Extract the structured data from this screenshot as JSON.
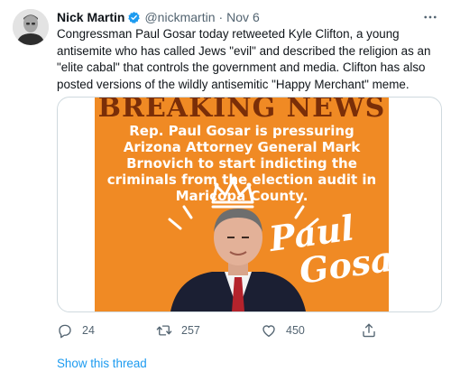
{
  "tweet": {
    "author_name": "Nick Martin",
    "handle": "@nickmartin",
    "separator": "·",
    "timestamp": "Nov 6",
    "body": "Congressman Paul Gosar today retweeted Kyle Clifton, a young antisemite who has called Jews \"evil\" and described the religion as an \"elite cabal\" that controls the government and media. Clifton has also posted versions of the wildly antisemitic \"Happy Merchant\" meme.",
    "media": {
      "headline": "BREAKING NEWS",
      "caption": "Rep. Paul Gosar is pressuring Arizona Attorney General Mark Brnovich to start indicting the criminals from the election audit in Maricopa County.",
      "signature_line1": "Paul",
      "signature_line2": "Gosar",
      "background_color": "#f08a24"
    },
    "actions": {
      "reply_count": "24",
      "retweet_count": "257",
      "like_count": "450"
    },
    "show_thread_label": "Show this thread"
  },
  "colors": {
    "link_blue": "#1d9bf0",
    "secondary_text": "#536471",
    "primary_text": "#0f1419",
    "verified_blue": "#1d9bf0"
  },
  "icons": [
    "verified-badge-icon",
    "more-icon",
    "reply-icon",
    "retweet-icon",
    "like-icon",
    "share-icon"
  ]
}
